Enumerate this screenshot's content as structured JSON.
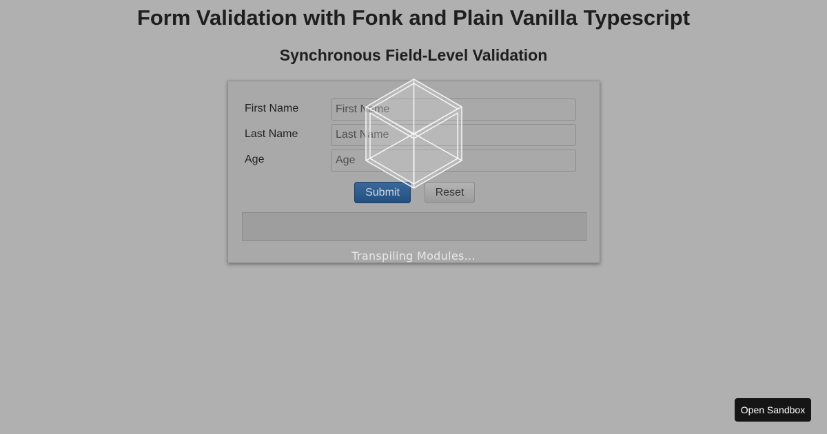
{
  "header": {
    "title": "Form Validation with Fonk and Plain Vanilla Typescript",
    "subtitle": "Synchronous Field-Level Validation"
  },
  "form": {
    "fields": [
      {
        "label": "First Name",
        "placeholder": "First Name",
        "value": ""
      },
      {
        "label": "Last Name",
        "placeholder": "Last Name",
        "value": ""
      },
      {
        "label": "Age",
        "placeholder": "Age",
        "value": ""
      }
    ],
    "submit_label": "Submit",
    "reset_label": "Reset"
  },
  "overlay": {
    "loading_text": "Transpiling Modules...",
    "loader_icon": "codesandbox-cube-icon"
  },
  "sandbox": {
    "open_label": "Open Sandbox"
  },
  "colors": {
    "background": "#b0b0b0",
    "submit": "#2e5c8c",
    "sandbox_button": "#151515"
  }
}
